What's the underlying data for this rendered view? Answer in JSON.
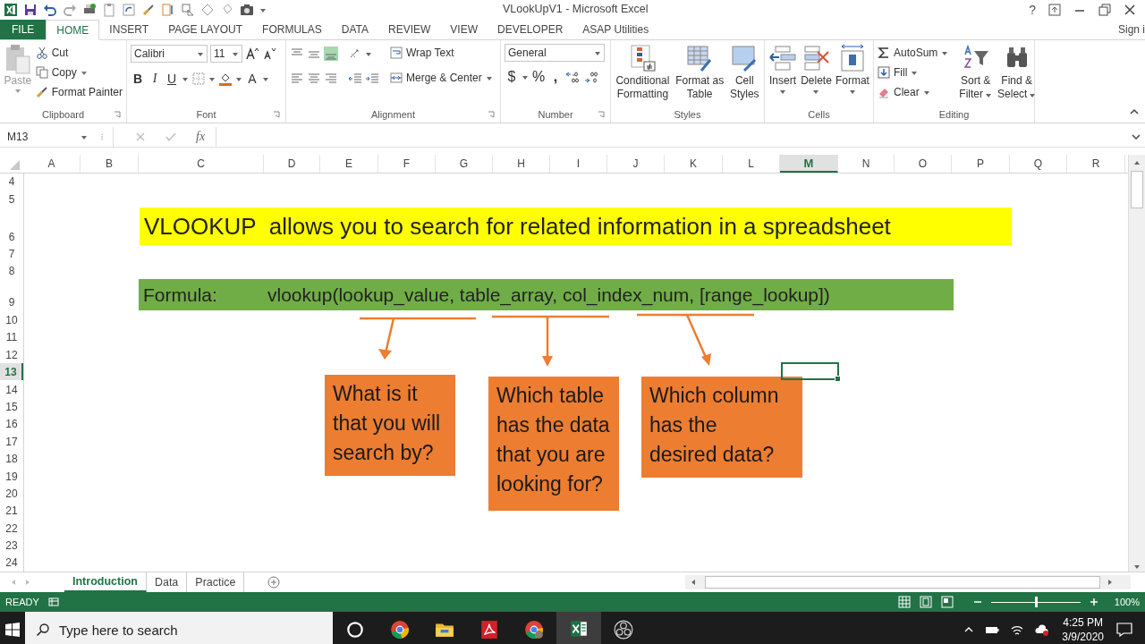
{
  "window": {
    "title": "VLookUpV1 - Microsoft Excel",
    "help": "?"
  },
  "ribbon_tabs": [
    {
      "label": "FILE",
      "kind": "file",
      "selected": false
    },
    {
      "label": "HOME",
      "kind": "tab",
      "selected": true
    },
    {
      "label": "INSERT",
      "kind": "tab",
      "selected": false
    },
    {
      "label": "PAGE LAYOUT",
      "kind": "tab",
      "selected": false
    },
    {
      "label": "FORMULAS",
      "kind": "tab",
      "selected": false
    },
    {
      "label": "DATA",
      "kind": "tab",
      "selected": false
    },
    {
      "label": "REVIEW",
      "kind": "tab",
      "selected": false
    },
    {
      "label": "VIEW",
      "kind": "tab",
      "selected": false
    },
    {
      "label": "DEVELOPER",
      "kind": "tab",
      "selected": false
    },
    {
      "label": "ASAP Utilities",
      "kind": "tab",
      "selected": false
    }
  ],
  "sign_in": "Sign i",
  "clipboard": {
    "label": "Clipboard",
    "paste": "Paste",
    "cut": "Cut",
    "copy": "Copy",
    "format_painter": "Format Painter"
  },
  "font": {
    "label": "Font",
    "name": "Calibri",
    "size": "11",
    "bold": "B",
    "italic": "I",
    "underline": "U",
    "font_color": "A"
  },
  "alignment": {
    "label": "Alignment",
    "wrap": "Wrap Text",
    "merge": "Merge & Center"
  },
  "number": {
    "label": "Number",
    "format": "General",
    "currency": "$",
    "percent": "%",
    "comma": ","
  },
  "styles": {
    "label": "Styles",
    "buttons": [
      {
        "lines": [
          "Conditional",
          "Formatting"
        ],
        "kind": "conditional"
      },
      {
        "lines": [
          "Format as",
          "Table"
        ],
        "kind": "table"
      },
      {
        "lines": [
          "Cell",
          "Styles"
        ],
        "kind": "cell"
      }
    ]
  },
  "cells": {
    "label": "Cells",
    "buttons": [
      {
        "label": "Insert",
        "kind": "insert"
      },
      {
        "label": "Delete",
        "kind": "delete"
      },
      {
        "label": "Format",
        "kind": "format"
      }
    ]
  },
  "editing": {
    "label": "Editing",
    "autosum": "AutoSum",
    "fill": "Fill",
    "clear": "Clear",
    "sort": [
      "Sort &",
      "Filter"
    ],
    "find": [
      "Find &",
      "Select"
    ]
  },
  "formula_bar": {
    "name_box": "M13",
    "fx": "fx"
  },
  "columns": [
    {
      "label": "A",
      "selected": false
    },
    {
      "label": "B",
      "selected": false
    },
    {
      "label": "C",
      "selected": false
    },
    {
      "label": "D",
      "selected": false
    },
    {
      "label": "E",
      "selected": false
    },
    {
      "label": "F",
      "selected": false
    },
    {
      "label": "G",
      "selected": false
    },
    {
      "label": "H",
      "selected": false
    },
    {
      "label": "I",
      "selected": false
    },
    {
      "label": "J",
      "selected": false
    },
    {
      "label": "K",
      "selected": false
    },
    {
      "label": "L",
      "selected": false
    },
    {
      "label": "M",
      "selected": true
    },
    {
      "label": "N",
      "selected": false
    },
    {
      "label": "O",
      "selected": false
    },
    {
      "label": "P",
      "selected": false
    },
    {
      "label": "Q",
      "selected": false
    },
    {
      "label": "R",
      "selected": false
    }
  ],
  "rows": [
    {
      "label": "4",
      "selected": false
    },
    {
      "label": "5",
      "selected": false
    },
    {
      "label": "6",
      "selected": false
    },
    {
      "label": "7",
      "selected": false
    },
    {
      "label": "8",
      "selected": false
    },
    {
      "label": "9",
      "selected": false
    },
    {
      "label": "10",
      "selected": false
    },
    {
      "label": "11",
      "selected": false
    },
    {
      "label": "12",
      "selected": false
    },
    {
      "label": "13",
      "selected": true
    },
    {
      "label": "14",
      "selected": false
    },
    {
      "label": "15",
      "selected": false
    },
    {
      "label": "16",
      "selected": false
    },
    {
      "label": "17",
      "selected": false
    },
    {
      "label": "18",
      "selected": false
    },
    {
      "label": "19",
      "selected": false
    },
    {
      "label": "20",
      "selected": false
    },
    {
      "label": "21",
      "selected": false
    },
    {
      "label": "22",
      "selected": false
    },
    {
      "label": "23",
      "selected": false
    },
    {
      "label": "24",
      "selected": false
    }
  ],
  "banner": "VLOOKUP  allows you to search for related information in a spreadsheet",
  "formula_banner": {
    "label": "Formula:",
    "formula": "vlookup(lookup_value, table_array, col_index_num, [range_lookup])"
  },
  "callouts": [
    {
      "text": "What is it that you will search by?"
    },
    {
      "text": "Which table has the data that you are looking for?"
    },
    {
      "text": "Which column has the desired data?"
    }
  ],
  "sheets": [
    {
      "label": "Introduction",
      "selected": true
    },
    {
      "label": "Data",
      "selected": false
    },
    {
      "label": "Practice",
      "selected": false
    }
  ],
  "status": {
    "mode": "READY",
    "zoom": "100%",
    "level": 0.5
  },
  "taskbar": {
    "search_placeholder": "Type here to search",
    "time": "4:25 PM",
    "date": "3/9/2020",
    "apps": [
      {
        "kind": "cortana",
        "selected": false
      },
      {
        "kind": "chrome",
        "selected": false
      },
      {
        "kind": "folder",
        "selected": false
      },
      {
        "kind": "pdf",
        "selected": false
      },
      {
        "kind": "chrome-user",
        "selected": false
      },
      {
        "kind": "excel",
        "selected": true
      },
      {
        "kind": "obs",
        "selected": false
      }
    ]
  }
}
